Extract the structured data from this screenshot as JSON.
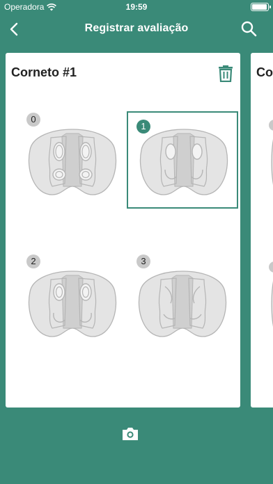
{
  "status_bar": {
    "carrier": "Operadora",
    "time": "19:59"
  },
  "nav": {
    "title": "Registrar avaliação"
  },
  "card": {
    "title": "Corneto #1",
    "options": [
      {
        "label": "0",
        "selected": false
      },
      {
        "label": "1",
        "selected": true
      },
      {
        "label": "2",
        "selected": false
      },
      {
        "label": "3",
        "selected": false
      }
    ]
  },
  "peek_card": {
    "title": "Co"
  },
  "colors": {
    "primary": "#3a8a78",
    "nose_fill": "#e4e4e4",
    "nose_stroke": "#b5b5b5",
    "badge": "#c9c9c9"
  },
  "icons": [
    "back-chevron-icon",
    "search-icon",
    "trash-icon",
    "camera-icon",
    "wifi-icon",
    "battery-icon"
  ]
}
